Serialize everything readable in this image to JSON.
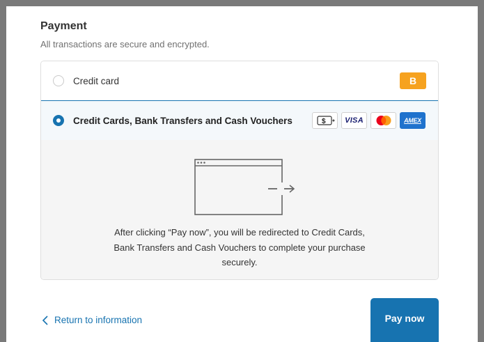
{
  "payment": {
    "title": "Payment",
    "subtitle": "All transactions are secure and encrypted."
  },
  "methods": [
    {
      "label": "Credit card",
      "selected": false,
      "badge_text": "B",
      "badge_color": "#f6a21f"
    },
    {
      "label": "Credit Cards, Bank Transfers and Cash Vouchers",
      "selected": true,
      "cards": [
        {
          "name": "cash-voucher-icon",
          "text": "$"
        },
        {
          "name": "visa-icon",
          "text": "VISA"
        },
        {
          "name": "mastercard-icon"
        },
        {
          "name": "amex-icon",
          "text": "AMEX"
        }
      ]
    }
  ],
  "details": {
    "redirect_text": "After clicking “Pay now”, you will be redirected to Credit Cards, Bank Transfers and Cash Vouchers to complete your purchase securely."
  },
  "footer": {
    "return_label": "Return to information",
    "pay_label": "Pay now"
  },
  "colors": {
    "accent": "#1773b0",
    "badge": "#f6a21f",
    "amex": "#1f72cd",
    "selected_bg": "#f4f8fb",
    "details_bg": "#f5f5f5"
  }
}
